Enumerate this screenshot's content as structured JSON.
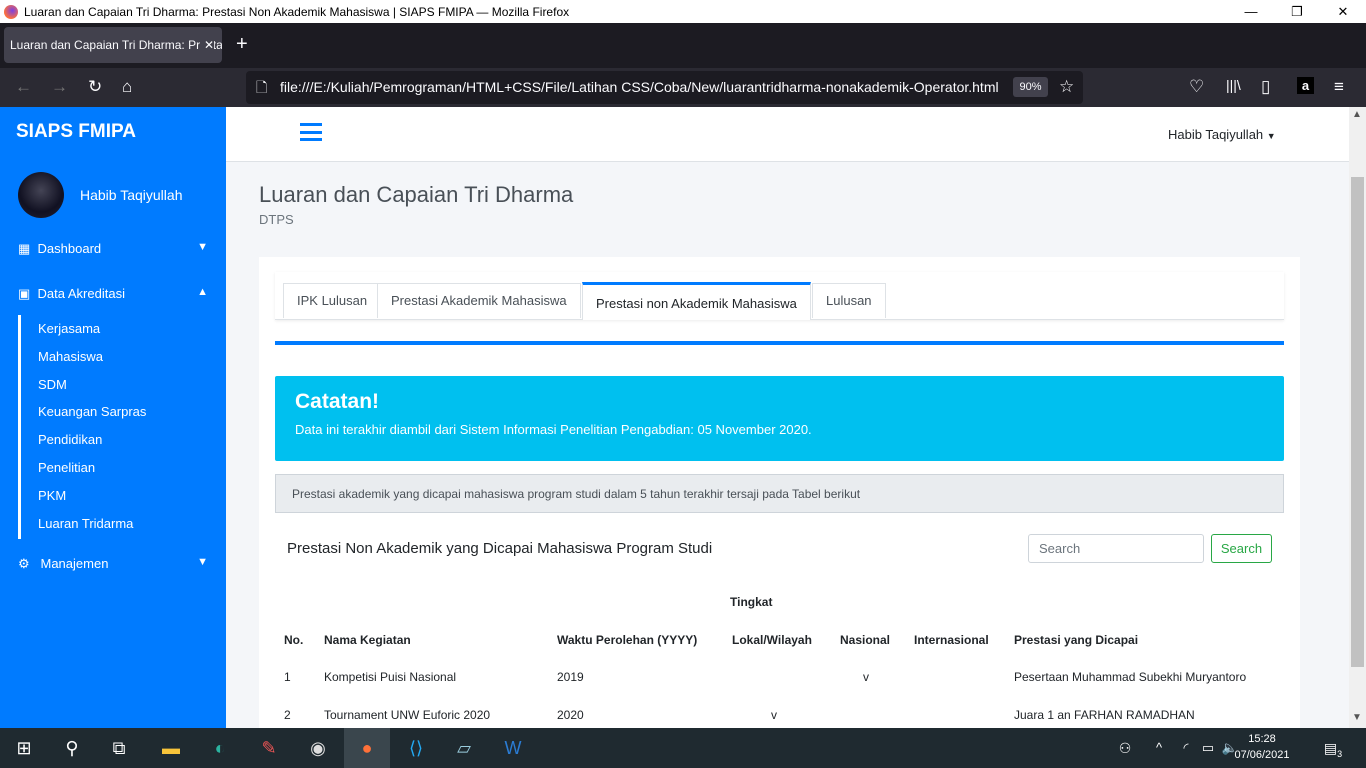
{
  "window": {
    "title": "Luaran dan Capaian Tri Dharma: Prestasi Non Akademik Mahasiswa | SIAPS FMIPA — Mozilla Firefox",
    "minimize": "—",
    "restore": "❐",
    "close": "✕"
  },
  "browser": {
    "tab_title": "Luaran dan Capaian Tri Dharma: Prestasi Non Akademik Mahasiswa",
    "tab_close": "✕",
    "new_tab": "+",
    "url": "file:///E:/Kuliah/Pemrograman/HTML+CSS/File/Latihan CSS/Coba/New/luarantridharma-nonakademik-Operator.html",
    "zoom": "90%"
  },
  "sidebar": {
    "brand": "SIAPS FMIPA",
    "user": "Habib Taqiyullah",
    "menu": [
      {
        "label": "Dashboard",
        "icon": "grid-icon"
      },
      {
        "label": "Data Akreditasi",
        "icon": "calendar-icon"
      },
      {
        "label": "Manajemen",
        "icon": "gear-icon"
      }
    ],
    "submenu": [
      "Kerjasama",
      "Mahasiswa",
      "SDM",
      "Keuangan Sarpras",
      "Pendidikan",
      "Penelitian",
      "PKM",
      "Luaran Tridarma"
    ]
  },
  "header": {
    "user": "Habib Taqiyullah"
  },
  "page": {
    "title": "Luaran dan Capaian Tri Dharma",
    "subtitle": "DTPS",
    "tabs": [
      "IPK Lulusan",
      "Prestasi Akademik Mahasiswa",
      "Prestasi non Akademik Mahasiswa",
      "Lulusan"
    ],
    "active_tab": 2,
    "callout": {
      "title": "Catatan!",
      "text": "Data ini terakhir diambil dari Sistem Informasi Penelitian Pengabdian: 05 November 2020."
    },
    "note": "Prestasi akademik yang dicapai mahasiswa program studi dalam 5 tahun terakhir tersaji pada Tabel berikut",
    "table_title": "Prestasi Non Akademik yang Dicapai Mahasiswa Program Studi",
    "search_placeholder": "Search",
    "search_button": "Search",
    "table": {
      "group_header": "Tingkat",
      "headers": [
        "No.",
        "Nama Kegiatan",
        "Waktu Perolehan (YYYY)",
        "Lokal/Wilayah",
        "Nasional",
        "Internasional",
        "Prestasi yang Dicapai"
      ],
      "rows": [
        [
          "1",
          "Kompetisi Puisi Nasional",
          "2019",
          "",
          "v",
          "",
          "Pesertaan Muhammad Subekhi Muryantoro"
        ],
        [
          "2",
          "Tournament UNW Euforic 2020",
          "2020",
          "v",
          "",
          "",
          "Juara 1 an FARHAN RAMADHAN"
        ]
      ]
    }
  },
  "taskbar": {
    "time": "15:28",
    "date": "07/06/2021",
    "notifications": "3"
  },
  "colors": {
    "primary": "#007bff",
    "info": "#00c0ef",
    "success": "#28a745"
  }
}
